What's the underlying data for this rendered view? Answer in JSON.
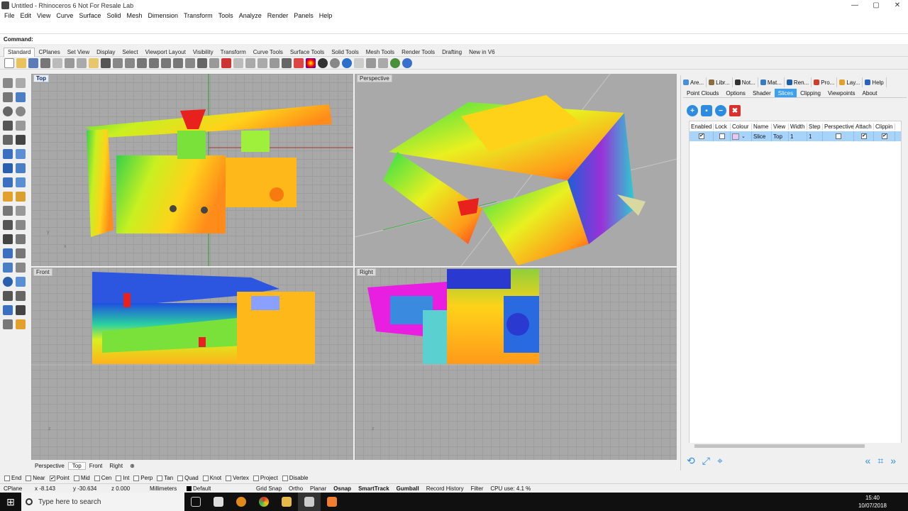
{
  "window": {
    "title": "Untitled - Rhinoceros 6 Not For Resale Lab",
    "min": "—",
    "max": "▢",
    "close": "✕"
  },
  "menu": [
    "File",
    "Edit",
    "View",
    "Curve",
    "Surface",
    "Solid",
    "Mesh",
    "Dimension",
    "Transform",
    "Tools",
    "Analyze",
    "Render",
    "Panels",
    "Help"
  ],
  "command": {
    "label": "Command:",
    "value": ""
  },
  "toolbar_tabs": [
    "Standard",
    "CPlanes",
    "Set View",
    "Display",
    "Select",
    "Viewport Layout",
    "Visibility",
    "Transform",
    "Curve Tools",
    "Surface Tools",
    "Solid Tools",
    "Mesh Tools",
    "Render Tools",
    "Drafting",
    "New in V6"
  ],
  "viewports": {
    "top": "Top",
    "perspective": "Perspective",
    "front": "Front",
    "right": "Right"
  },
  "viewport_tabs": [
    "Perspective",
    "Top",
    "Front",
    "Right"
  ],
  "viewport_tab_add": "⊕",
  "panel": {
    "tabs_top": [
      {
        "label": "Are...",
        "color": "#4a90d9"
      },
      {
        "label": "Libr...",
        "color": "#8c6d3f"
      },
      {
        "label": "Not...",
        "color": "#333333"
      },
      {
        "label": "Mat...",
        "color": "#3b7bbf"
      },
      {
        "label": "Ren...",
        "color": "#1e5fa8"
      },
      {
        "label": "Pro...",
        "color": "#d33a2c"
      },
      {
        "label": "Lay...",
        "color": "#e2a12a"
      },
      {
        "label": "Help",
        "color": "#2a64c2"
      }
    ],
    "tabs_sub": [
      "Point Clouds",
      "Options",
      "Shader",
      "Slices",
      "Clipping",
      "Viewpoints",
      "About"
    ],
    "tools": [
      {
        "name": "add",
        "glyph": "+",
        "color": "#2d8ce0"
      },
      {
        "name": "edit",
        "glyph": "▪",
        "color": "#2d8ce0"
      },
      {
        "name": "remove",
        "glyph": "−",
        "color": "#2d8ce0"
      },
      {
        "name": "delete",
        "glyph": "✖",
        "color": "#d9302c"
      }
    ],
    "table": {
      "headers": [
        "Enabled",
        "Lock",
        "Colour",
        "Name",
        "View",
        "Width",
        "Step",
        "Perspective",
        "Attach",
        "Clippin"
      ],
      "row": {
        "enabled": "✔",
        "lock": "",
        "colour": "#e8c8f0",
        "name": "Slice",
        "view": "Top",
        "width": "1",
        "step": "1",
        "perspective": "",
        "attach": "✔",
        "clipping": "✔"
      }
    },
    "bottom_left": [
      "⟲",
      "⤢",
      "⌖"
    ],
    "bottom_right": [
      "«",
      "⌗",
      "»"
    ]
  },
  "osnap": [
    {
      "label": "End",
      "checked": false
    },
    {
      "label": "Near",
      "checked": false
    },
    {
      "label": "Point",
      "checked": true
    },
    {
      "label": "Mid",
      "checked": false
    },
    {
      "label": "Cen",
      "checked": false
    },
    {
      "label": "Int",
      "checked": false
    },
    {
      "label": "Perp",
      "checked": false
    },
    {
      "label": "Tan",
      "checked": false
    },
    {
      "label": "Quad",
      "checked": false
    },
    {
      "label": "Knot",
      "checked": false
    },
    {
      "label": "Vertex",
      "checked": false
    },
    {
      "label": "Project",
      "checked": false
    },
    {
      "label": "Disable",
      "checked": false
    }
  ],
  "status": {
    "cplane": "CPlane",
    "x": "x -8.143",
    "y": "y -30.634",
    "z": "z 0.000",
    "units": "Millimeters",
    "layer": "Default",
    "toggles": [
      "Grid Snap",
      "Ortho",
      "Planar",
      "Osnap",
      "SmartTrack",
      "Gumball",
      "Record History",
      "Filter"
    ],
    "cpu": "CPU use: 4.1 %"
  },
  "taskbar": {
    "search_placeholder": "Type here to search",
    "time": "15:40",
    "date": "10/07/2018"
  }
}
